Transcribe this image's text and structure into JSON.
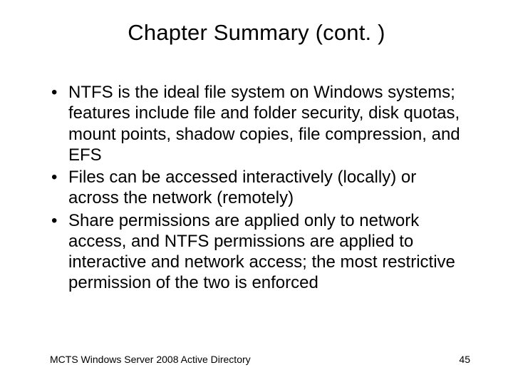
{
  "title": "Chapter Summary (cont. )",
  "bullets": [
    "NTFS is the ideal file system on Windows systems; features include file and folder security, disk quotas, mount points, shadow copies, file compression, and EFS",
    "Files can be accessed interactively (locally) or across the network (remotely)",
    "Share permissions are applied only to network access, and NTFS permissions are applied to interactive and network access; the most restrictive permission of the two is enforced"
  ],
  "footer_left": "MCTS Windows Server 2008 Active Directory",
  "footer_right": "45"
}
